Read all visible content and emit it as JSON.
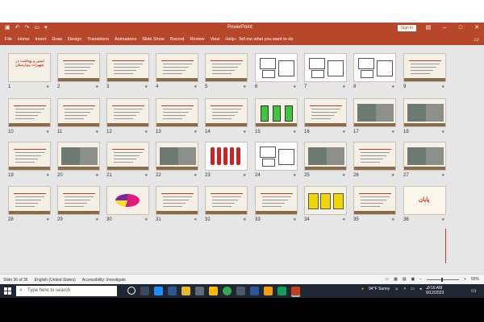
{
  "titlebar": {
    "app_title": "PowerPoint",
    "signin_label": "Sign in",
    "minimize": "–",
    "maximize": "□",
    "close": "✕"
  },
  "ribbon": {
    "tabs": [
      "File",
      "Home",
      "Insert",
      "Draw",
      "Design",
      "Transitions",
      "Animations",
      "Slide Show",
      "Record",
      "Review",
      "View",
      "Help"
    ],
    "tell_me": "Tell me what you want to do"
  },
  "slides": [
    {
      "num": "1",
      "kind": "title",
      "text": "ایمنی و بهداشت\nدر\nتجهیزات\nبیمارستان"
    },
    {
      "num": "2",
      "kind": "text"
    },
    {
      "num": "3",
      "kind": "text"
    },
    {
      "num": "4",
      "kind": "text"
    },
    {
      "num": "5",
      "kind": "text"
    },
    {
      "num": "6",
      "kind": "diagram"
    },
    {
      "num": "7",
      "kind": "diagram"
    },
    {
      "num": "8",
      "kind": "diagram"
    },
    {
      "num": "9",
      "kind": "text"
    },
    {
      "num": "10",
      "kind": "text"
    },
    {
      "num": "11",
      "kind": "text"
    },
    {
      "num": "12",
      "kind": "text"
    },
    {
      "num": "13",
      "kind": "text"
    },
    {
      "num": "14",
      "kind": "text"
    },
    {
      "num": "15",
      "kind": "green"
    },
    {
      "num": "16",
      "kind": "text"
    },
    {
      "num": "17",
      "kind": "photo"
    },
    {
      "num": "18",
      "kind": "photo"
    },
    {
      "num": "19",
      "kind": "text"
    },
    {
      "num": "20",
      "kind": "photo"
    },
    {
      "num": "21",
      "kind": "text"
    },
    {
      "num": "22",
      "kind": "photo"
    },
    {
      "num": "23",
      "kind": "ext"
    },
    {
      "num": "24",
      "kind": "diagram"
    },
    {
      "num": "25",
      "kind": "photo"
    },
    {
      "num": "26",
      "kind": "text"
    },
    {
      "num": "27",
      "kind": "photo"
    },
    {
      "num": "28",
      "kind": "text"
    },
    {
      "num": "29",
      "kind": "text"
    },
    {
      "num": "30",
      "kind": "pie"
    },
    {
      "num": "31",
      "kind": "text"
    },
    {
      "num": "32",
      "kind": "text"
    },
    {
      "num": "33",
      "kind": "text"
    },
    {
      "num": "34",
      "kind": "yellow"
    },
    {
      "num": "35",
      "kind": "text"
    },
    {
      "num": "36",
      "kind": "end",
      "text": "پایان"
    }
  ],
  "status": {
    "slide_info": "Slide 36 of 36",
    "language": "English (United States)",
    "accessibility": "Accessibility: Investigate",
    "zoom": "55%"
  },
  "taskbar": {
    "search_placeholder": "Type here to search",
    "weather": "94°F  Sunny",
    "time": "8:16 AM",
    "date": "9/12/2023"
  },
  "colors": {
    "ribbon": "#b7472a",
    "taskbar": "#1f2733",
    "sorter_bg": "#e6e6e6"
  }
}
